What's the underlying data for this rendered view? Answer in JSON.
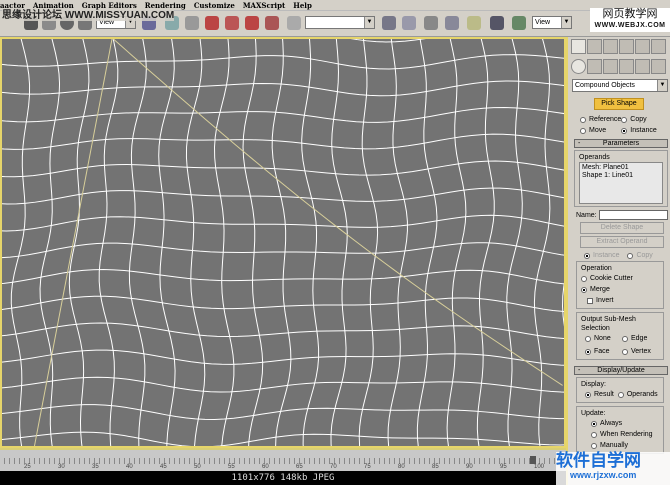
{
  "menu": [
    "aactor",
    "Animation",
    "Graph Editors",
    "Rendering",
    "Customize",
    "MAXScript",
    "Help"
  ],
  "watermarks": {
    "top_left": "思缘设计论坛 WWW.MISSYUAN.COM",
    "top_right_cn": "网页教学网",
    "top_right_url": "WWW.WEBJX.COM",
    "bottom_right_cn": "软件自学网",
    "bottom_right_url": "www.rjzxw.com"
  },
  "toolbar": {
    "view_select": "View",
    "view_select2": "View"
  },
  "panel": {
    "category": "Compound Objects",
    "pick_shape": "Pick Shape",
    "pick_options": [
      {
        "label": "Reference",
        "on": false
      },
      {
        "label": "Copy",
        "on": false
      },
      {
        "label": "Move",
        "on": false
      },
      {
        "label": "Instance",
        "on": true
      }
    ],
    "parameters": "Parameters",
    "operands_label": "Operands",
    "operands": [
      "Mesh: Plane01",
      "Shape 1: Line01"
    ],
    "name_label": "Name:",
    "delete_shape": "Delete Shape",
    "extract_operand": "Extract Operand",
    "extract_options": [
      {
        "label": "Instance",
        "on": true
      },
      {
        "label": "Copy",
        "on": false
      }
    ],
    "operation_label": "Operation",
    "operation": [
      {
        "label": "Cookie Cutter",
        "on": false
      },
      {
        "label": "Merge",
        "on": true
      }
    ],
    "invert": "Invert",
    "output_label": "Output Sub-Mesh Selection",
    "output": [
      {
        "label": "None",
        "on": false
      },
      {
        "label": "Edge",
        "on": false
      },
      {
        "label": "Face",
        "on": true
      },
      {
        "label": "Vertex",
        "on": false
      }
    ],
    "display_update": "Display/Update",
    "display_label": "Display:",
    "display": [
      {
        "label": "Result",
        "on": true
      },
      {
        "label": "Operands",
        "on": false
      }
    ],
    "update_label": "Update:",
    "update": [
      {
        "label": "Always",
        "on": true
      },
      {
        "label": "When Rendering",
        "on": false
      },
      {
        "label": "Manually",
        "on": false
      }
    ]
  },
  "ruler": {
    "labels": [
      "25",
      "30",
      "35",
      "40",
      "45",
      "50",
      "55",
      "60",
      "65",
      "70",
      "75",
      "80",
      "85",
      "90",
      "95",
      "100"
    ]
  },
  "status": "1101x776  148kb  JPEG",
  "colors": {
    "viewport": "#737373",
    "border": "#e6d56a",
    "mesh": "#ffffff",
    "spline": "#d8cf9a"
  }
}
